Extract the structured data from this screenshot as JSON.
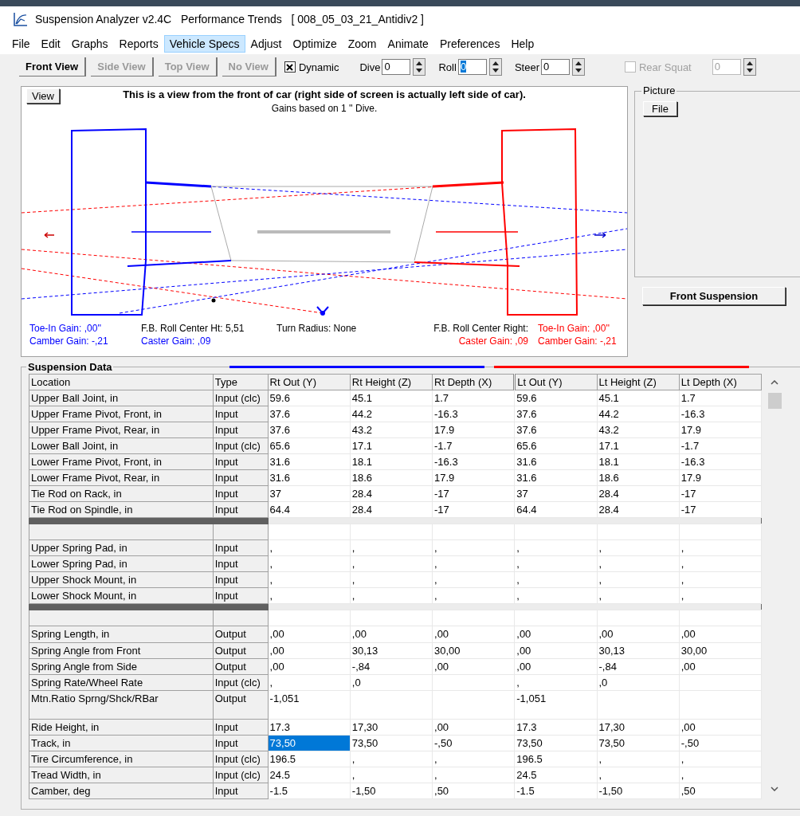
{
  "window": {
    "title": "Suspension Analyzer v2.4C   Performance Trends   [ 008_05_03_21_Antidiv2 ]"
  },
  "menu": [
    {
      "label": "File",
      "selected": false
    },
    {
      "label": "Edit",
      "selected": false
    },
    {
      "label": "Graphs",
      "selected": false
    },
    {
      "label": "Reports",
      "selected": false
    },
    {
      "label": "Vehicle Specs",
      "selected": true
    },
    {
      "label": "Adjust",
      "selected": false
    },
    {
      "label": "Optimize",
      "selected": false
    },
    {
      "label": "Zoom",
      "selected": false
    },
    {
      "label": "Animate",
      "selected": false
    },
    {
      "label": "Preferences",
      "selected": false
    },
    {
      "label": "Help",
      "selected": false
    }
  ],
  "tabs": [
    {
      "label": "Front View",
      "selected": true
    },
    {
      "label": "Side View",
      "selected": false
    },
    {
      "label": "Top View",
      "selected": false
    },
    {
      "label": "No View",
      "selected": false
    }
  ],
  "dynamic": {
    "label": "Dynamic",
    "checked": true
  },
  "spinners": [
    {
      "label": "Dive",
      "value": "0",
      "focused": false
    },
    {
      "label": "Roll",
      "value": "0",
      "focused": true
    },
    {
      "label": "Steer",
      "value": "0",
      "focused": false
    }
  ],
  "rear_squat": {
    "label": "Rear Squat",
    "checked": false,
    "disabled": true,
    "value": "0"
  },
  "view_panel": {
    "button": "View",
    "caption": "This is a view from the front of car (right side of screen is actually left side of car).",
    "subcaption": "Gains based on 1 '' Dive.",
    "readouts_top": [
      {
        "text": "Toe-In Gain: ,00''",
        "color": "#0000ff"
      },
      {
        "text": "F.B. Roll Center Ht: 5,51",
        "color": "#000000"
      },
      {
        "text": "Turn Radius: None",
        "color": "#000000"
      },
      {
        "text": "F.B. Roll Center Right:",
        "color": "#000000"
      },
      {
        "text": "Toe-In Gain: ,00''",
        "color": "#ff0000"
      }
    ],
    "readouts_bottom_left": [
      {
        "text": "Camber Gain: -,21",
        "color": "#0000ff"
      },
      {
        "text": "Caster Gain: ,09",
        "color": "#0000ff"
      }
    ],
    "readouts_bottom_right": [
      {
        "text": "Caster Gain: ,09",
        "color": "#ff0000"
      },
      {
        "text": "Camber Gain: -,21",
        "color": "#ff0000"
      }
    ]
  },
  "picture_group": {
    "title": "Picture",
    "button": "File"
  },
  "front_suspension_button": "Front Suspension",
  "suspension_data": {
    "title": "Suspension Data",
    "columns": [
      "Location",
      "Type",
      "Rt Out (Y)",
      "Rt Height (Z)",
      "Rt Depth (X)",
      "Lt Out (Y)",
      "Lt Height (Z)",
      "Lt Depth (X)"
    ],
    "rows": [
      {
        "kind": "data",
        "location": "Upper Ball Joint, in",
        "type": "Input (clc)",
        "cells": [
          {
            "text": "59.6",
            "selected": false
          },
          {
            "text": "45.1",
            "selected": false
          },
          {
            "text": "1.7",
            "selected": false
          },
          {
            "text": "59.6",
            "selected": false
          },
          {
            "text": "45.1",
            "selected": false
          },
          {
            "text": "1.7",
            "selected": false
          }
        ]
      },
      {
        "kind": "data",
        "location": "Upper Frame Pivot, Front, in",
        "type": "Input",
        "cells": [
          {
            "text": "37.6",
            "selected": false
          },
          {
            "text": "44.2",
            "selected": false
          },
          {
            "text": "-16.3",
            "selected": false
          },
          {
            "text": "37.6",
            "selected": false
          },
          {
            "text": "44.2",
            "selected": false
          },
          {
            "text": "-16.3",
            "selected": false
          }
        ]
      },
      {
        "kind": "data",
        "location": "Upper Frame Pivot, Rear, in",
        "type": "Input",
        "cells": [
          {
            "text": "37.6",
            "selected": false
          },
          {
            "text": "43.2",
            "selected": false
          },
          {
            "text": "17.9",
            "selected": false
          },
          {
            "text": "37.6",
            "selected": false
          },
          {
            "text": "43.2",
            "selected": false
          },
          {
            "text": "17.9",
            "selected": false
          }
        ]
      },
      {
        "kind": "data",
        "location": "Lower Ball Joint, in",
        "type": "Input (clc)",
        "cells": [
          {
            "text": "65.6",
            "selected": false
          },
          {
            "text": "17.1",
            "selected": false
          },
          {
            "text": "-1.7",
            "selected": false
          },
          {
            "text": "65.6",
            "selected": false
          },
          {
            "text": "17.1",
            "selected": false
          },
          {
            "text": "-1.7",
            "selected": false
          }
        ]
      },
      {
        "kind": "data",
        "location": "Lower Frame Pivot, Front, in",
        "type": "Input",
        "cells": [
          {
            "text": "31.6",
            "selected": false
          },
          {
            "text": "18.1",
            "selected": false
          },
          {
            "text": "-16.3",
            "selected": false
          },
          {
            "text": "31.6",
            "selected": false
          },
          {
            "text": "18.1",
            "selected": false
          },
          {
            "text": "-16.3",
            "selected": false
          }
        ]
      },
      {
        "kind": "data",
        "location": "Lower Frame Pivot, Rear, in",
        "type": "Input",
        "cells": [
          {
            "text": "31.6",
            "selected": false
          },
          {
            "text": "18.6",
            "selected": false
          },
          {
            "text": "17.9",
            "selected": false
          },
          {
            "text": "31.6",
            "selected": false
          },
          {
            "text": "18.6",
            "selected": false
          },
          {
            "text": "17.9",
            "selected": false
          }
        ]
      },
      {
        "kind": "data",
        "location": "Tie Rod on Rack, in",
        "type": "Input",
        "cells": [
          {
            "text": "37",
            "selected": false
          },
          {
            "text": "28.4",
            "selected": false
          },
          {
            "text": "-17",
            "selected": false
          },
          {
            "text": "37",
            "selected": false
          },
          {
            "text": "28.4",
            "selected": false
          },
          {
            "text": "-17",
            "selected": false
          }
        ]
      },
      {
        "kind": "data",
        "location": "Tie Rod on Spindle, in",
        "type": "Input",
        "cells": [
          {
            "text": "64.4",
            "selected": false
          },
          {
            "text": "28.4",
            "selected": false
          },
          {
            "text": "-17",
            "selected": false
          },
          {
            "text": "64.4",
            "selected": false
          },
          {
            "text": "28.4",
            "selected": false
          },
          {
            "text": "-17",
            "selected": false
          }
        ]
      },
      {
        "kind": "separator"
      },
      {
        "kind": "blank"
      },
      {
        "kind": "data",
        "location": "Upper Spring Pad, in",
        "type": "Input",
        "cells": [
          {
            "text": ",",
            "selected": false
          },
          {
            "text": ",",
            "selected": false
          },
          {
            "text": ",",
            "selected": false
          },
          {
            "text": ",",
            "selected": false
          },
          {
            "text": ",",
            "selected": false
          },
          {
            "text": ",",
            "selected": false
          }
        ]
      },
      {
        "kind": "data",
        "location": "Lower Spring Pad, in",
        "type": "Input",
        "cells": [
          {
            "text": ",",
            "selected": false
          },
          {
            "text": ",",
            "selected": false
          },
          {
            "text": ",",
            "selected": false
          },
          {
            "text": ",",
            "selected": false
          },
          {
            "text": ",",
            "selected": false
          },
          {
            "text": ",",
            "selected": false
          }
        ]
      },
      {
        "kind": "data",
        "location": "Upper Shock Mount, in",
        "type": "Input",
        "cells": [
          {
            "text": ",",
            "selected": false
          },
          {
            "text": ",",
            "selected": false
          },
          {
            "text": ",",
            "selected": false
          },
          {
            "text": ",",
            "selected": false
          },
          {
            "text": ",",
            "selected": false
          },
          {
            "text": ",",
            "selected": false
          }
        ]
      },
      {
        "kind": "data",
        "location": "Lower Shock Mount, in",
        "type": "Input",
        "cells": [
          {
            "text": ",",
            "selected": false
          },
          {
            "text": ",",
            "selected": false
          },
          {
            "text": ",",
            "selected": false
          },
          {
            "text": ",",
            "selected": false
          },
          {
            "text": ",",
            "selected": false
          },
          {
            "text": ",",
            "selected": false
          }
        ]
      },
      {
        "kind": "separator"
      },
      {
        "kind": "blank"
      },
      {
        "kind": "data",
        "location": "Spring Length, in",
        "type": "Output",
        "cells": [
          {
            "text": ",00",
            "selected": false
          },
          {
            "text": ",00",
            "selected": false
          },
          {
            "text": ",00",
            "selected": false
          },
          {
            "text": ",00",
            "selected": false
          },
          {
            "text": ",00",
            "selected": false
          },
          {
            "text": ",00",
            "selected": false
          }
        ]
      },
      {
        "kind": "data",
        "location": "Spring Angle from Front",
        "type": "Output",
        "cells": [
          {
            "text": ",00",
            "selected": false
          },
          {
            "text": "30,13",
            "selected": false
          },
          {
            "text": "30,00",
            "selected": false
          },
          {
            "text": ",00",
            "selected": false
          },
          {
            "text": "30,13",
            "selected": false
          },
          {
            "text": "30,00",
            "selected": false
          }
        ]
      },
      {
        "kind": "data",
        "location": "Spring Angle from Side",
        "type": "Output",
        "cells": [
          {
            "text": ",00",
            "selected": false
          },
          {
            "text": "-,84",
            "selected": false
          },
          {
            "text": ",00",
            "selected": false
          },
          {
            "text": ",00",
            "selected": false
          },
          {
            "text": "-,84",
            "selected": false
          },
          {
            "text": ",00",
            "selected": false
          }
        ]
      },
      {
        "kind": "data",
        "location": "Spring Rate/Wheel Rate",
        "type": "Input (clc)",
        "cells": [
          {
            "text": ",",
            "selected": false
          },
          {
            "text": ",0",
            "selected": false
          },
          {
            "selected": false
          },
          {
            "text": ",",
            "selected": false
          },
          {
            "text": ",0",
            "selected": false
          },
          {
            "selected": false
          }
        ]
      },
      {
        "kind": "tall",
        "location": "Mtn.Ratio Sprng/Shck/RBar",
        "type": "Output",
        "cells": [
          {
            "text": "-1,051",
            "selected": false
          },
          {
            "selected": false
          },
          {
            "selected": false
          },
          {
            "text": "-1,051",
            "selected": false
          },
          {
            "selected": false
          },
          {
            "selected": false
          }
        ]
      },
      {
        "kind": "data",
        "location": "Ride Height, in",
        "type": "Input",
        "cells": [
          {
            "text": "17.3",
            "selected": false
          },
          {
            "text": "17,30",
            "selected": false
          },
          {
            "text": ",00",
            "selected": false
          },
          {
            "text": "17.3",
            "selected": false
          },
          {
            "text": "17,30",
            "selected": false
          },
          {
            "text": ",00",
            "selected": false
          }
        ]
      },
      {
        "kind": "data",
        "location": "Track, in",
        "type": "Input",
        "cells": [
          {
            "text": "73,50",
            "selected": true
          },
          {
            "text": "73,50",
            "selected": false
          },
          {
            "text": "-,50",
            "selected": false
          },
          {
            "text": "73,50",
            "selected": false
          },
          {
            "text": "73,50",
            "selected": false
          },
          {
            "text": "-,50",
            "selected": false
          }
        ]
      },
      {
        "kind": "data",
        "location": "Tire Circumference, in",
        "type": "Input (clc)",
        "cells": [
          {
            "text": "196.5",
            "selected": false
          },
          {
            "text": ",",
            "selected": false
          },
          {
            "text": ",",
            "selected": false
          },
          {
            "text": "196.5",
            "selected": false
          },
          {
            "text": ",",
            "selected": false
          },
          {
            "text": ",",
            "selected": false
          }
        ]
      },
      {
        "kind": "data",
        "location": "Tread Width, in",
        "type": "Input (clc)",
        "cells": [
          {
            "text": "24.5",
            "selected": false
          },
          {
            "text": ",",
            "selected": false
          },
          {
            "text": ",",
            "selected": false
          },
          {
            "text": "24.5",
            "selected": false
          },
          {
            "text": ",",
            "selected": false
          },
          {
            "text": ",",
            "selected": false
          }
        ]
      },
      {
        "kind": "data",
        "location": "Camber, deg",
        "type": "Input",
        "cells": [
          {
            "text": "-1.5",
            "selected": false
          },
          {
            "text": "-1,50",
            "selected": false
          },
          {
            "text": ",50",
            "selected": false
          },
          {
            "text": "-1.5",
            "selected": false
          },
          {
            "text": "-1,50",
            "selected": false
          },
          {
            "text": ",50",
            "selected": false
          }
        ]
      }
    ]
  }
}
